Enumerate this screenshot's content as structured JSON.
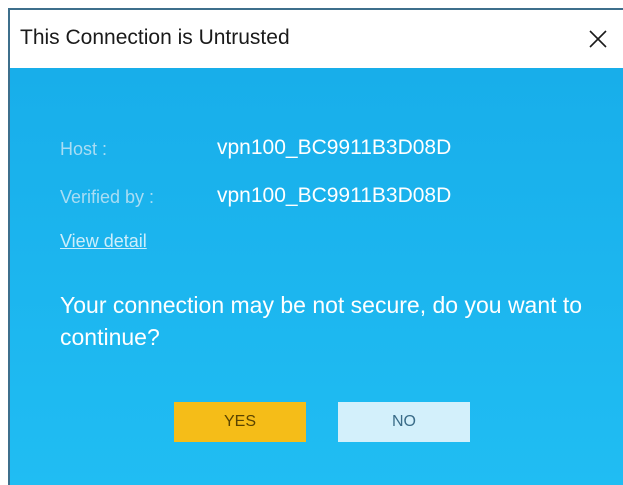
{
  "window": {
    "title": "This Connection is Untrusted",
    "close_icon": "close-icon"
  },
  "details": {
    "host_label": "Host :",
    "host_value": "vpn100_BC9911B3D08D",
    "verified_label": "Verified by :",
    "verified_value": "vpn100_BC9911B3D08D",
    "view_detail_link": "View detail"
  },
  "message": "Your connection may be not secure, do you want to continue?",
  "buttons": {
    "yes_label": "YES",
    "no_label": "NO"
  },
  "colors": {
    "dialog_background": "#1ab2ec",
    "yes_button": "#f5bd18",
    "no_button": "#d3f0fb"
  }
}
